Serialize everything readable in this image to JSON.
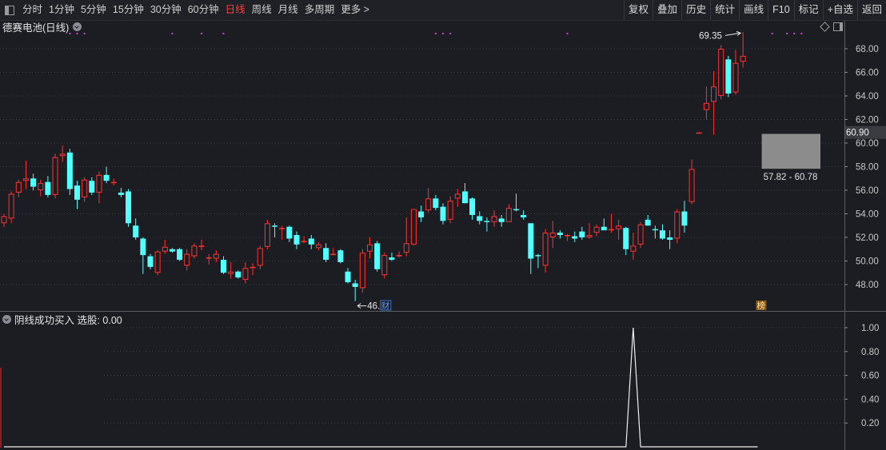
{
  "toolbar": {
    "periods": [
      "分时",
      "1分钟",
      "5分钟",
      "15分钟",
      "30分钟",
      "60分钟",
      "日线",
      "周线",
      "月线",
      "多周期",
      "更多 >"
    ],
    "active_period": "日线",
    "buttons": [
      "复权",
      "叠加",
      "历史",
      "统计",
      "画线",
      "F10",
      "标记",
      "+自选",
      "返回"
    ]
  },
  "main_chart": {
    "title": "德赛电池(日线)",
    "price_tag": "60.90",
    "high_marker": "69.35",
    "low_marker": "46.59",
    "range_label": "57.82 - 60.78",
    "badge_cai": "财",
    "badge_bang": "榜"
  },
  "sub_chart": {
    "title": "阴线成功买入  选股: 0.00"
  },
  "colors": {
    "up": "#ff3232",
    "down": "#54ffff",
    "grid": "#3a3d44",
    "axis_text": "#c8c8c8",
    "highlight": "#ff3b3b"
  },
  "chart_data": [
    {
      "type": "candlestick",
      "title": "德赛电池(日线)",
      "y_ticks": [
        48.0,
        50.0,
        52.0,
        54.0,
        56.0,
        58.0,
        60.0,
        62.0,
        64.0,
        66.0,
        68.0
      ],
      "ylim": [
        46.0,
        70.0
      ],
      "grid": true,
      "annotations": [
        {
          "text": "69.35",
          "kind": "high"
        },
        {
          "text": "46.59",
          "kind": "low"
        },
        {
          "text": "57.82 - 60.78",
          "kind": "range-box"
        },
        {
          "text": "60.90",
          "kind": "last-price"
        }
      ],
      "candles": [
        {
          "o": 53.2,
          "h": 54.0,
          "l": 52.9,
          "c": 53.8
        },
        {
          "o": 53.6,
          "h": 55.9,
          "l": 53.2,
          "c": 55.7
        },
        {
          "o": 55.8,
          "h": 56.9,
          "l": 55.4,
          "c": 56.7
        },
        {
          "o": 56.8,
          "h": 58.5,
          "l": 56.1,
          "c": 57.0
        },
        {
          "o": 57.0,
          "h": 57.4,
          "l": 56.0,
          "c": 56.3
        },
        {
          "o": 56.0,
          "h": 56.9,
          "l": 55.5,
          "c": 56.6
        },
        {
          "o": 56.7,
          "h": 57.2,
          "l": 55.4,
          "c": 55.6
        },
        {
          "o": 55.6,
          "h": 59.1,
          "l": 55.3,
          "c": 58.8
        },
        {
          "o": 58.9,
          "h": 59.8,
          "l": 58.4,
          "c": 59.1
        },
        {
          "o": 59.2,
          "h": 59.5,
          "l": 55.6,
          "c": 56.1
        },
        {
          "o": 56.4,
          "h": 56.8,
          "l": 54.4,
          "c": 55.2
        },
        {
          "o": 55.4,
          "h": 57.1,
          "l": 55.0,
          "c": 56.9
        },
        {
          "o": 56.8,
          "h": 57.1,
          "l": 55.6,
          "c": 55.8
        },
        {
          "o": 55.8,
          "h": 57.6,
          "l": 54.9,
          "c": 57.3
        },
        {
          "o": 57.3,
          "h": 58.0,
          "l": 56.6,
          "c": 56.8
        },
        {
          "o": 56.7,
          "h": 57.0,
          "l": 56.4,
          "c": 56.7
        },
        {
          "o": 55.8,
          "h": 56.2,
          "l": 55.4,
          "c": 55.6
        },
        {
          "o": 55.9,
          "h": 56.1,
          "l": 52.9,
          "c": 53.2
        },
        {
          "o": 53.0,
          "h": 53.6,
          "l": 51.8,
          "c": 52.0
        },
        {
          "o": 51.9,
          "h": 52.0,
          "l": 48.9,
          "c": 50.5
        },
        {
          "o": 50.4,
          "h": 50.6,
          "l": 49.3,
          "c": 49.5
        },
        {
          "o": 49.0,
          "h": 50.9,
          "l": 48.8,
          "c": 50.8
        },
        {
          "o": 50.8,
          "h": 51.8,
          "l": 50.6,
          "c": 51.2
        },
        {
          "o": 51.0,
          "h": 51.1,
          "l": 50.7,
          "c": 50.8
        },
        {
          "o": 51.0,
          "h": 51.1,
          "l": 50.0,
          "c": 50.1
        },
        {
          "o": 49.6,
          "h": 51.0,
          "l": 49.2,
          "c": 50.6
        },
        {
          "o": 50.4,
          "h": 51.5,
          "l": 50.2,
          "c": 51.3
        },
        {
          "o": 51.3,
          "h": 51.8,
          "l": 50.9,
          "c": 51.3
        },
        {
          "o": 50.2,
          "h": 50.6,
          "l": 49.7,
          "c": 50.3
        },
        {
          "o": 50.2,
          "h": 50.9,
          "l": 49.9,
          "c": 50.6
        },
        {
          "o": 50.1,
          "h": 50.4,
          "l": 48.9,
          "c": 49.0
        },
        {
          "o": 48.9,
          "h": 49.9,
          "l": 48.5,
          "c": 49.1
        },
        {
          "o": 49.1,
          "h": 49.2,
          "l": 48.5,
          "c": 48.6
        },
        {
          "o": 48.4,
          "h": 49.9,
          "l": 48.1,
          "c": 49.4
        },
        {
          "o": 49.4,
          "h": 49.8,
          "l": 48.8,
          "c": 49.5
        },
        {
          "o": 49.6,
          "h": 51.3,
          "l": 49.3,
          "c": 51.1
        },
        {
          "o": 51.2,
          "h": 53.5,
          "l": 51.0,
          "c": 53.2
        },
        {
          "o": 53.0,
          "h": 53.2,
          "l": 52.0,
          "c": 52.9
        },
        {
          "o": 52.8,
          "h": 53.0,
          "l": 51.8,
          "c": 52.8
        },
        {
          "o": 52.9,
          "h": 53.0,
          "l": 51.6,
          "c": 51.9
        },
        {
          "o": 52.2,
          "h": 52.5,
          "l": 51.0,
          "c": 51.4
        },
        {
          "o": 51.7,
          "h": 52.1,
          "l": 51.5,
          "c": 51.7
        },
        {
          "o": 51.9,
          "h": 52.2,
          "l": 51.0,
          "c": 51.4
        },
        {
          "o": 51.1,
          "h": 51.6,
          "l": 50.9,
          "c": 51.4
        },
        {
          "o": 51.1,
          "h": 51.5,
          "l": 49.9,
          "c": 50.1
        },
        {
          "o": 50.6,
          "h": 51.1,
          "l": 50.5,
          "c": 50.6
        },
        {
          "o": 50.9,
          "h": 51.0,
          "l": 49.8,
          "c": 49.9
        },
        {
          "o": 49.1,
          "h": 49.4,
          "l": 48.1,
          "c": 48.2
        },
        {
          "o": 48.1,
          "h": 48.4,
          "l": 46.6,
          "c": 47.8
        },
        {
          "o": 47.7,
          "h": 51.0,
          "l": 47.3,
          "c": 50.7
        },
        {
          "o": 50.8,
          "h": 52.0,
          "l": 50.2,
          "c": 51.4
        },
        {
          "o": 51.5,
          "h": 51.7,
          "l": 49.1,
          "c": 49.3
        },
        {
          "o": 48.8,
          "h": 50.7,
          "l": 48.5,
          "c": 50.5
        },
        {
          "o": 50.3,
          "h": 50.7,
          "l": 50.0,
          "c": 50.1
        },
        {
          "o": 50.4,
          "h": 50.8,
          "l": 50.3,
          "c": 50.5
        },
        {
          "o": 50.7,
          "h": 53.7,
          "l": 50.4,
          "c": 51.5
        },
        {
          "o": 51.4,
          "h": 54.4,
          "l": 51.3,
          "c": 54.4
        },
        {
          "o": 54.2,
          "h": 54.7,
          "l": 53.3,
          "c": 53.7
        },
        {
          "o": 54.3,
          "h": 56.2,
          "l": 54.1,
          "c": 55.3
        },
        {
          "o": 55.3,
          "h": 55.6,
          "l": 54.3,
          "c": 54.5
        },
        {
          "o": 54.6,
          "h": 54.9,
          "l": 53.1,
          "c": 53.4
        },
        {
          "o": 53.5,
          "h": 55.5,
          "l": 53.2,
          "c": 55.1
        },
        {
          "o": 55.3,
          "h": 56.1,
          "l": 54.6,
          "c": 55.7
        },
        {
          "o": 55.9,
          "h": 56.6,
          "l": 54.9,
          "c": 54.9
        },
        {
          "o": 55.3,
          "h": 55.4,
          "l": 53.5,
          "c": 53.9
        },
        {
          "o": 53.8,
          "h": 54.2,
          "l": 53.1,
          "c": 53.4
        },
        {
          "o": 53.4,
          "h": 53.7,
          "l": 52.5,
          "c": 53.3
        },
        {
          "o": 53.3,
          "h": 54.3,
          "l": 52.9,
          "c": 53.8
        },
        {
          "o": 53.6,
          "h": 53.9,
          "l": 52.9,
          "c": 53.3
        },
        {
          "o": 53.3,
          "h": 54.8,
          "l": 53.3,
          "c": 54.5
        },
        {
          "o": 54.4,
          "h": 55.7,
          "l": 54.2,
          "c": 54.3
        },
        {
          "o": 53.9,
          "h": 54.3,
          "l": 53.5,
          "c": 53.7
        },
        {
          "o": 53.2,
          "h": 53.2,
          "l": 48.9,
          "c": 50.2
        },
        {
          "o": 50.5,
          "h": 50.6,
          "l": 49.4,
          "c": 50.4
        },
        {
          "o": 49.6,
          "h": 52.7,
          "l": 49.0,
          "c": 52.4
        },
        {
          "o": 52.0,
          "h": 53.4,
          "l": 51.1,
          "c": 52.4
        },
        {
          "o": 52.4,
          "h": 52.6,
          "l": 51.9,
          "c": 52.2
        },
        {
          "o": 52.1,
          "h": 52.3,
          "l": 51.7,
          "c": 52.2
        },
        {
          "o": 52.1,
          "h": 52.5,
          "l": 51.6,
          "c": 51.9
        },
        {
          "o": 52.5,
          "h": 52.9,
          "l": 51.8,
          "c": 52.0
        },
        {
          "o": 52.0,
          "h": 53.2,
          "l": 51.9,
          "c": 52.2
        },
        {
          "o": 52.4,
          "h": 53.1,
          "l": 52.1,
          "c": 52.9
        },
        {
          "o": 52.9,
          "h": 53.6,
          "l": 52.7,
          "c": 52.6
        },
        {
          "o": 52.6,
          "h": 54.0,
          "l": 52.4,
          "c": 52.7
        },
        {
          "o": 52.7,
          "h": 53.5,
          "l": 51.8,
          "c": 53.0
        },
        {
          "o": 52.8,
          "h": 52.9,
          "l": 50.5,
          "c": 51.0
        },
        {
          "o": 50.8,
          "h": 52.4,
          "l": 50.1,
          "c": 51.3
        },
        {
          "o": 51.4,
          "h": 53.3,
          "l": 51.1,
          "c": 53.1
        },
        {
          "o": 53.5,
          "h": 53.9,
          "l": 53.0,
          "c": 53.0
        },
        {
          "o": 52.7,
          "h": 53.0,
          "l": 51.9,
          "c": 52.6
        },
        {
          "o": 52.6,
          "h": 53.1,
          "l": 51.8,
          "c": 51.9
        },
        {
          "o": 52.0,
          "h": 52.6,
          "l": 51.0,
          "c": 51.8
        },
        {
          "o": 51.9,
          "h": 54.4,
          "l": 51.5,
          "c": 54.2
        },
        {
          "o": 54.2,
          "h": 55.1,
          "l": 52.4,
          "c": 53.0
        },
        {
          "o": 55.0,
          "h": 58.6,
          "l": 54.8,
          "c": 57.8
        },
        {
          "o": 60.8,
          "h": 60.9,
          "l": 60.8,
          "c": 60.9
        },
        {
          "o": 62.8,
          "h": 64.8,
          "l": 62.0,
          "c": 63.4
        },
        {
          "o": 63.5,
          "h": 66.1,
          "l": 60.7,
          "c": 64.8
        },
        {
          "o": 64.0,
          "h": 68.3,
          "l": 63.7,
          "c": 68.0
        },
        {
          "o": 67.1,
          "h": 67.4,
          "l": 63.9,
          "c": 64.2
        },
        {
          "o": 64.3,
          "h": 67.9,
          "l": 64.1,
          "c": 66.8
        },
        {
          "o": 66.9,
          "h": 69.4,
          "l": 66.4,
          "c": 67.4
        }
      ]
    },
    {
      "type": "line",
      "title": "阴线成功买入  选股: 0.00",
      "y_ticks": [
        0.2,
        0.4,
        0.6,
        0.8,
        1.0
      ],
      "ylim": [
        0.0,
        1.1
      ],
      "series": [
        {
          "values_note_index": 86,
          "values": [
            0,
            0,
            0,
            0,
            0,
            0,
            0,
            0,
            0,
            0,
            0,
            0,
            0,
            0,
            0,
            0,
            0,
            0,
            0,
            0,
            0,
            0,
            0,
            0,
            0,
            0,
            0,
            0,
            0,
            0,
            0,
            0,
            0,
            0,
            0,
            0,
            0,
            0,
            0,
            0,
            0,
            0,
            0,
            0,
            0,
            0,
            0,
            0,
            0,
            0,
            0,
            0,
            0,
            0,
            0,
            0,
            0,
            0,
            0,
            0,
            0,
            0,
            0,
            0,
            0,
            0,
            0,
            0,
            0,
            0,
            0,
            0,
            0,
            0,
            0,
            0,
            0,
            0,
            0,
            0,
            0,
            0,
            0,
            0,
            0,
            0,
            1,
            0,
            0,
            0,
            0,
            0,
            0,
            0,
            0,
            0,
            0,
            0,
            0,
            0,
            0,
            0,
            0,
            0
          ]
        }
      ]
    }
  ]
}
